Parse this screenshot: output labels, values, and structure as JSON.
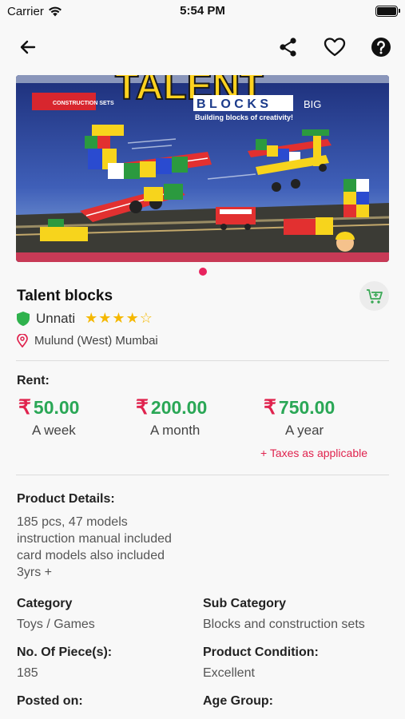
{
  "status_bar": {
    "carrier": "Carrier",
    "time": "5:54 PM"
  },
  "nav": {
    "back_icon": "arrow-left-icon",
    "share_icon": "share-icon",
    "favorite_icon": "heart-outline-icon",
    "help_icon": "question-circle-icon"
  },
  "product": {
    "image": {
      "box_brand": "TALENT",
      "box_subtitle": "BLOCKS",
      "box_subtitle_suffix": "BIG",
      "box_tagline": "Building blocks of creativity!",
      "box_tag": "CONSTRUCTION SETS"
    },
    "carousel": {
      "total": 1,
      "active": 1
    },
    "title": "Talent blocks",
    "seller": "Unnati",
    "rating": 4,
    "rating_max": 5,
    "location": "Mulund (West) Mumbai"
  },
  "rent": {
    "label": "Rent:",
    "currency_symbol": "₹",
    "options": [
      {
        "price": "50.00",
        "period": "A week"
      },
      {
        "price": "200.00",
        "period": "A month"
      },
      {
        "price": "750.00",
        "period": "A year"
      }
    ],
    "taxes_note": "+ Taxes as applicable"
  },
  "details": {
    "label": "Product Details:",
    "text": "185 pcs, 47 models\ninstruction manual included\ncard models also included\n3yrs +"
  },
  "attributes": {
    "category_label": "Category",
    "category_value": "Toys / Games",
    "subcategory_label": "Sub Category",
    "subcategory_value": "Blocks and construction sets",
    "pieces_label": "No. Of Piece(s):",
    "pieces_value": "185",
    "condition_label": "Product Condition:",
    "condition_value": "Excellent",
    "posted_label": "Posted on:",
    "age_label": "Age Group:"
  },
  "colors": {
    "accent_green": "#2aa756",
    "accent_pink": "#e0234e",
    "star": "#f5b800"
  }
}
